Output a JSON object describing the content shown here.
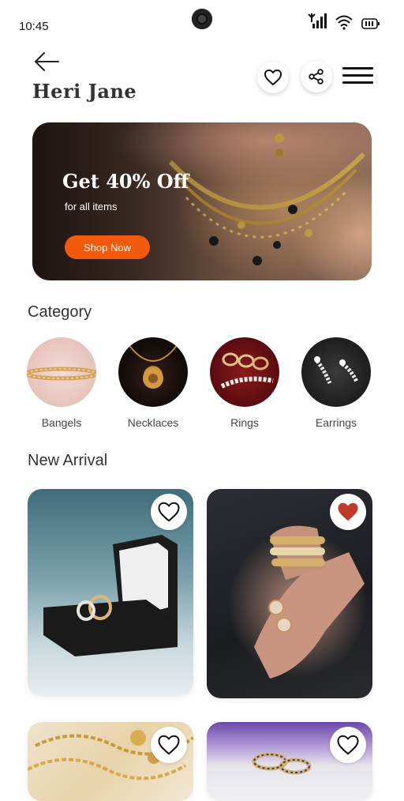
{
  "status_bar": {
    "time": "10:45"
  },
  "header": {
    "brand": "Heri Jane"
  },
  "banner": {
    "title": "Get 40% Off",
    "subtitle": "for all items",
    "cta": "Shop Now"
  },
  "category": {
    "title": "Category",
    "items": [
      {
        "label": "Bangels"
      },
      {
        "label": "Necklaces"
      },
      {
        "label": "Rings"
      },
      {
        "label": "Earrings"
      }
    ]
  },
  "new_arrival": {
    "title": "New Arrival",
    "products": [
      {
        "favorited": false
      },
      {
        "favorited": true
      },
      {
        "favorited": false
      },
      {
        "favorited": false
      }
    ]
  },
  "colors": {
    "accent": "#f25a0d",
    "favorite": "#c0392b",
    "text": "#333333"
  }
}
